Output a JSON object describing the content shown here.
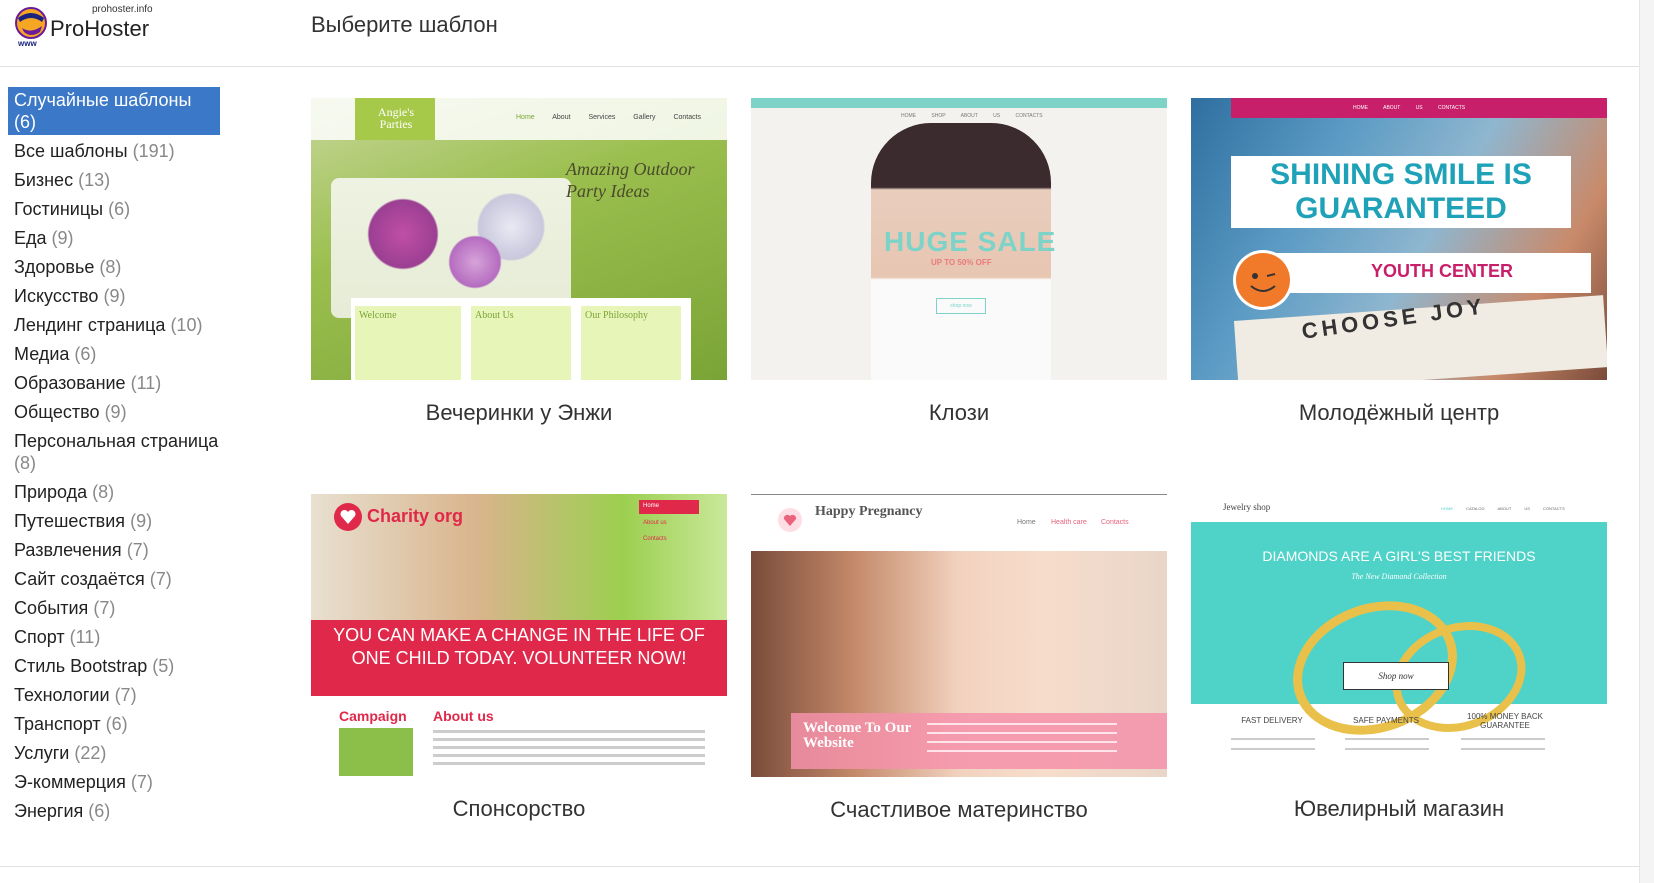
{
  "logo": {
    "small": "prohoster.info",
    "big": "ProHoster",
    "www": "www"
  },
  "page_title": "Выберите шаблон",
  "categories": [
    {
      "label": "Случайные шаблоны",
      "count": "(6)",
      "active": true
    },
    {
      "label": "Все шаблоны",
      "count": "(191)"
    },
    {
      "label": "Бизнес",
      "count": "(13)"
    },
    {
      "label": "Гостиницы",
      "count": "(6)"
    },
    {
      "label": "Еда",
      "count": "(9)"
    },
    {
      "label": "Здоровье",
      "count": "(8)"
    },
    {
      "label": "Искусство",
      "count": "(9)"
    },
    {
      "label": "Лендинг страница",
      "count": "(10)"
    },
    {
      "label": "Медиа",
      "count": "(6)"
    },
    {
      "label": "Образование",
      "count": "(11)"
    },
    {
      "label": "Общество",
      "count": "(9)"
    },
    {
      "label": "Персональная страница",
      "count": "(8)"
    },
    {
      "label": "Природа",
      "count": "(8)"
    },
    {
      "label": "Путешествия",
      "count": "(9)"
    },
    {
      "label": "Развлечения",
      "count": "(7)"
    },
    {
      "label": "Сайт создаётся",
      "count": "(7)"
    },
    {
      "label": "События",
      "count": "(7)"
    },
    {
      "label": "Спорт",
      "count": "(11)"
    },
    {
      "label": "Стиль Bootstrap",
      "count": "(5)"
    },
    {
      "label": "Технологии",
      "count": "(7)"
    },
    {
      "label": "Транспорт",
      "count": "(6)"
    },
    {
      "label": "Услуги",
      "count": "(22)"
    },
    {
      "label": "Э-коммерция",
      "count": "(7)"
    },
    {
      "label": "Энергия",
      "count": "(6)"
    }
  ],
  "templates": [
    {
      "title": "Вечеринки у Энжи",
      "preview": {
        "brand": "Angie's Parties",
        "nav": [
          "Home",
          "About",
          "Services",
          "Gallery",
          "Contacts"
        ],
        "headline": "Amazing Outdoor Party Ideas",
        "boxes": [
          "Welcome",
          "About Us",
          "Our Philosophy"
        ]
      }
    },
    {
      "title": "Клози",
      "preview": {
        "nav": [
          "HOME",
          "SHOP",
          "ABOUT US",
          "CONTACTS"
        ],
        "headline": "HUGE SALE",
        "sub": "UP TO 50% OFF",
        "button": "shop now"
      }
    },
    {
      "title": "Молодёжный центр",
      "preview": {
        "nav": [
          "HOME",
          "ABOUT US",
          "CONTACTS"
        ],
        "headline": "SHINING SMILE IS GUARANTEED",
        "sub": "YOUTH CENTER",
        "sign": "CHOOSE JOY"
      }
    },
    {
      "title": "Спонсорство",
      "preview": {
        "brand": "Charity org",
        "nav": [
          "Home",
          "About us",
          "Contacts"
        ],
        "headline": "YOU CAN MAKE A CHANGE IN THE LIFE OF ONE CHILD TODAY. VOLUNTEER NOW!",
        "col1": "Campaign",
        "col2": "About us"
      }
    },
    {
      "title": "Счастливое материнство",
      "preview": {
        "brand": "Happy Pregnancy",
        "nav": [
          "Home",
          "Health care",
          "Contacts"
        ],
        "headline": "Welcome To Our Website"
      }
    },
    {
      "title": "Ювелирный магазин",
      "preview": {
        "brand": "Jewelry shop",
        "nav": [
          "HOME",
          "CATALOG",
          "ABOUT US",
          "CONTACTS"
        ],
        "headline": "DIAMONDS ARE A GIRL'S BEST FRIENDS",
        "sub": "The New Diamond Collection",
        "button": "Shop now",
        "features": [
          "FAST DELIVERY",
          "SAFE PAYMENTS",
          "100% MONEY BACK GUARANTEE"
        ]
      }
    }
  ]
}
